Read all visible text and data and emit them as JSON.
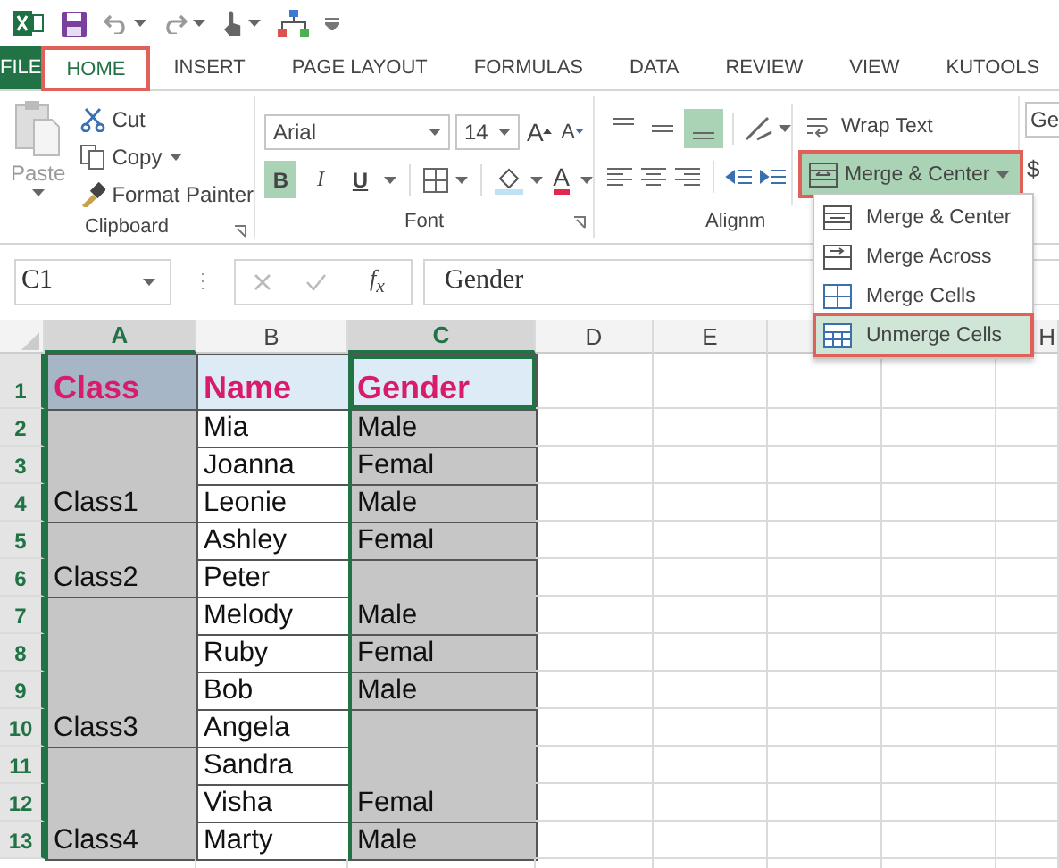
{
  "tabs": [
    {
      "label": "FILE",
      "kind": "file",
      "selected": false,
      "callout": false
    },
    {
      "label": "HOME",
      "kind": "tab",
      "selected": true,
      "callout": true
    },
    {
      "label": "INSERT",
      "kind": "tab",
      "selected": false,
      "callout": false
    },
    {
      "label": "PAGE LAYOUT",
      "kind": "tab",
      "selected": false,
      "callout": false
    },
    {
      "label": "FORMULAS",
      "kind": "tab",
      "selected": false,
      "callout": false
    },
    {
      "label": "DATA",
      "kind": "tab",
      "selected": false,
      "callout": false
    },
    {
      "label": "REVIEW",
      "kind": "tab",
      "selected": false,
      "callout": false
    },
    {
      "label": "VIEW",
      "kind": "tab",
      "selected": false,
      "callout": false
    },
    {
      "label": "KUTOOLS",
      "kind": "tab",
      "selected": false,
      "callout": false
    }
  ],
  "clipboard": {
    "paste": "Paste",
    "cut": "Cut",
    "copy": "Copy",
    "format_painter": "Format Painter",
    "label": "Clipboard"
  },
  "font": {
    "name": "Arial",
    "size": "14",
    "grow": "A",
    "shrink": "A",
    "label": "Font",
    "font_color": "A",
    "styles": [
      {
        "label": "B",
        "kind": "bold",
        "on": true
      },
      {
        "label": "I",
        "kind": "italic",
        "on": false
      },
      {
        "label": "U",
        "kind": "underline",
        "on": false
      }
    ]
  },
  "alignment": {
    "label": "Alignm",
    "bottom_align_on": true,
    "wrap_text": "Wrap Text",
    "merge_button": {
      "label": "Merge & Center",
      "callout": true
    }
  },
  "number": {
    "format": "Ge",
    "currency": "$"
  },
  "formula_bar": {
    "name_box": "C1",
    "function_label": "f$_{x}$",
    "formula": "Gender"
  },
  "sheet": {
    "column_headers": [
      {
        "label": "A",
        "selected": true
      },
      {
        "label": "B",
        "selected": false
      },
      {
        "label": "C",
        "selected": true
      },
      {
        "label": "D",
        "selected": false
      },
      {
        "label": "E",
        "selected": false
      },
      {
        "label": "H",
        "selected": false
      }
    ],
    "rows": [
      {
        "header": "1",
        "selected": true,
        "cells": [
          {
            "text": "Class",
            "kind": "header",
            "selected": true,
            "active": false
          },
          {
            "text": "Name",
            "kind": "header",
            "selected": false,
            "active": false
          },
          {
            "text": "Gender",
            "kind": "header",
            "selected": true,
            "active": true
          }
        ]
      },
      {
        "header": "2",
        "selected": true,
        "cells": [
          {
            "kind": "merge_start"
          },
          {
            "text": "Mia",
            "kind": "data",
            "selected": false,
            "active": false
          },
          {
            "text": "Male",
            "kind": "data",
            "selected": true,
            "active": false
          }
        ]
      },
      {
        "header": "3",
        "selected": true,
        "cells": [
          {
            "kind": "merge_mid"
          },
          {
            "text": "Joanna",
            "kind": "data",
            "selected": false,
            "active": false
          },
          {
            "text": "Femal",
            "kind": "data",
            "selected": true,
            "active": false
          }
        ]
      },
      {
        "header": "4",
        "selected": true,
        "cells": [
          {
            "text": "Class1",
            "kind": "merge_end",
            "selected": true,
            "active": false
          },
          {
            "text": "Leonie",
            "kind": "data",
            "selected": false,
            "active": false
          },
          {
            "text": "Male",
            "kind": "data",
            "selected": true,
            "active": false
          }
        ]
      },
      {
        "header": "5",
        "selected": true,
        "cells": [
          {
            "kind": "merge_start"
          },
          {
            "text": "Ashley",
            "kind": "data",
            "selected": false,
            "active": false
          },
          {
            "text": "Femal",
            "kind": "data",
            "selected": true,
            "active": false
          }
        ]
      },
      {
        "header": "6",
        "selected": true,
        "cells": [
          {
            "text": "Class2",
            "kind": "merge_end",
            "selected": true,
            "active": false
          },
          {
            "text": "Peter",
            "kind": "data",
            "selected": false,
            "active": false
          },
          {
            "kind": "merge_start"
          }
        ]
      },
      {
        "header": "7",
        "selected": true,
        "cells": [
          {
            "kind": "merge_start"
          },
          {
            "text": "Melody",
            "kind": "data",
            "selected": false,
            "active": false
          },
          {
            "text": "Male",
            "kind": "merge_end",
            "selected": true,
            "active": false
          }
        ]
      },
      {
        "header": "8",
        "selected": true,
        "cells": [
          {
            "kind": "merge_mid"
          },
          {
            "text": "Ruby",
            "kind": "data",
            "selected": false,
            "active": false
          },
          {
            "text": "Femal",
            "kind": "data",
            "selected": true,
            "active": false
          }
        ]
      },
      {
        "header": "9",
        "selected": true,
        "cells": [
          {
            "kind": "merge_mid"
          },
          {
            "text": "Bob",
            "kind": "data",
            "selected": false,
            "active": false
          },
          {
            "text": "Male",
            "kind": "data",
            "selected": true,
            "active": false
          }
        ]
      },
      {
        "header": "10",
        "selected": true,
        "cells": [
          {
            "text": "Class3",
            "kind": "merge_end",
            "selected": true,
            "active": false
          },
          {
            "text": "Angela",
            "kind": "data",
            "selected": false,
            "active": false
          },
          {
            "kind": "merge_start"
          }
        ]
      },
      {
        "header": "11",
        "selected": true,
        "cells": [
          {
            "kind": "merge_start"
          },
          {
            "text": "Sandra",
            "kind": "data",
            "selected": false,
            "active": false
          },
          {
            "kind": "merge_mid"
          }
        ]
      },
      {
        "header": "12",
        "selected": true,
        "cells": [
          {
            "kind": "merge_mid"
          },
          {
            "text": "Visha",
            "kind": "data",
            "selected": false,
            "active": false
          },
          {
            "text": "Femal",
            "kind": "merge_end",
            "selected": true,
            "active": false
          }
        ]
      },
      {
        "header": "13",
        "selected": true,
        "cells": [
          {
            "text": "Class4",
            "kind": "merge_end",
            "selected": true,
            "active": false
          },
          {
            "text": "Marty",
            "kind": "data",
            "selected": false,
            "active": false
          },
          {
            "text": "Male",
            "kind": "data",
            "selected": true,
            "active": false
          }
        ]
      }
    ]
  },
  "merge_menu": {
    "items": [
      {
        "label": "Merge & Center",
        "kind": "center",
        "selected": false,
        "callout": false
      },
      {
        "label": "Merge Across",
        "kind": "across",
        "selected": false,
        "callout": false
      },
      {
        "label": "Merge Cells",
        "kind": "cells",
        "selected": false,
        "callout": false
      },
      {
        "label": "Unmerge Cells",
        "kind": "unmerge",
        "selected": true,
        "callout": true
      }
    ]
  }
}
